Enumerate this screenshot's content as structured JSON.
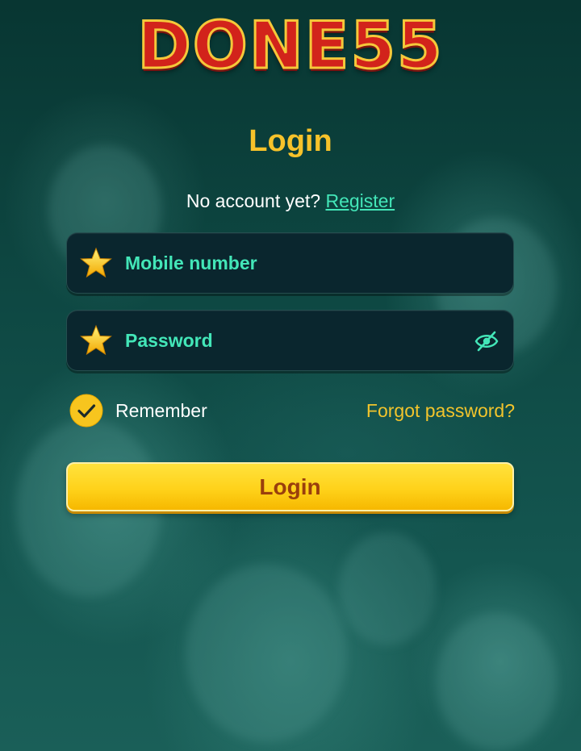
{
  "brand": {
    "logo_text": "DONE55"
  },
  "page": {
    "title": "Login",
    "register_prompt": "No account yet?",
    "register_link": "Register"
  },
  "form": {
    "mobile": {
      "placeholder": "Mobile number",
      "icon": "star-icon"
    },
    "password": {
      "placeholder": "Password",
      "icon": "star-icon",
      "toggle_icon": "eye-off-icon"
    },
    "remember_label": "Remember",
    "remember_checked": true,
    "forgot_label": "Forgot password?",
    "submit_label": "Login"
  },
  "colors": {
    "background": "#0b3c39",
    "accent_yellow": "#f7c22a",
    "link_green": "#43e6b8",
    "logo_red": "#d2231b",
    "field_bg": "#0a262e"
  }
}
